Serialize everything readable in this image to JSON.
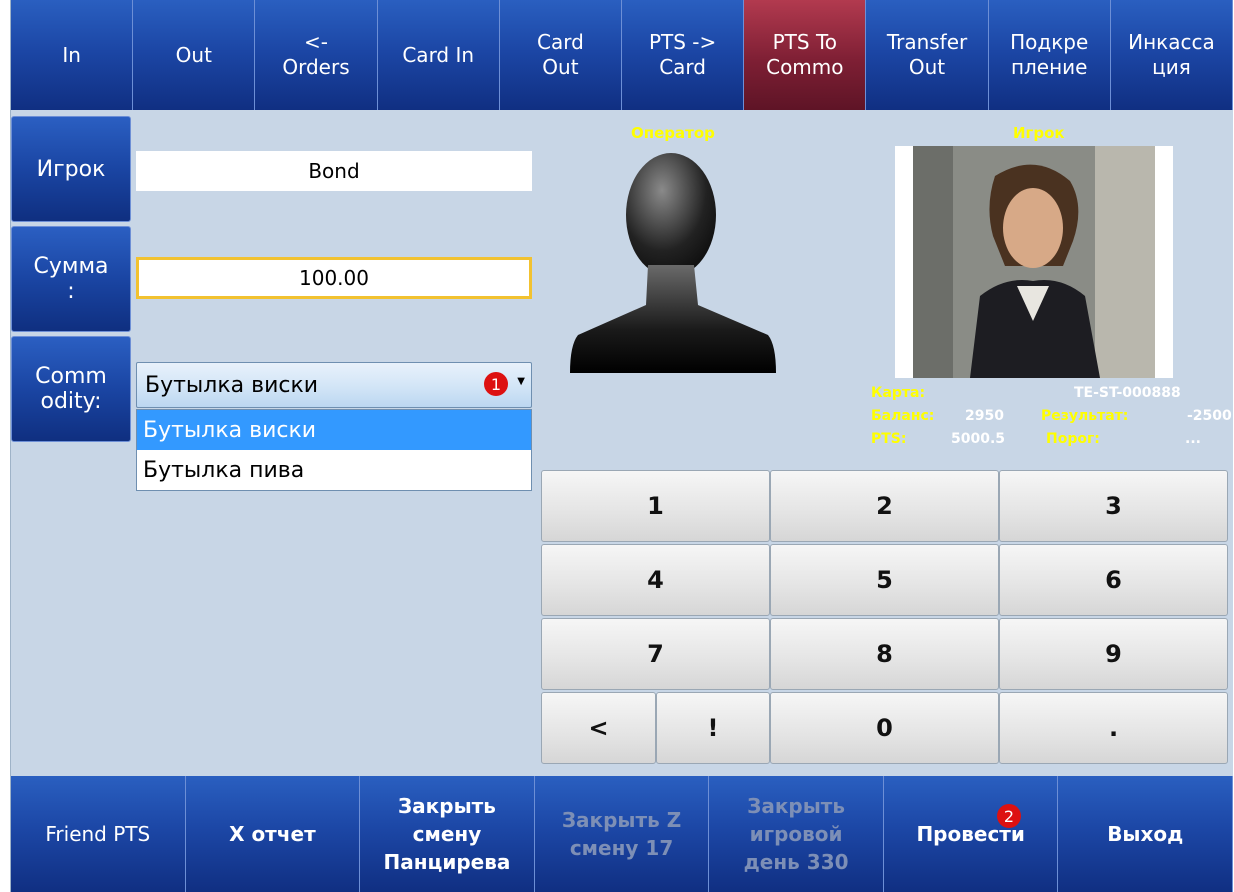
{
  "top_tabs": [
    {
      "label": "In"
    },
    {
      "label": "Out"
    },
    {
      "label": "<-\nOrders"
    },
    {
      "label": "Card In"
    },
    {
      "label": "Card\nOut"
    },
    {
      "label": "PTS ->\nCard"
    },
    {
      "label": "PTS To\nCommo",
      "active": true
    },
    {
      "label": "Transfer\nOut"
    },
    {
      "label": "Подкре\nпление"
    },
    {
      "label": "Инкасса\nция"
    }
  ],
  "form": {
    "player_button": "Игрок",
    "player_value": "Bond",
    "sum_button": "Сумма\n:",
    "sum_value": "100.00",
    "commodity_button": "Comm\nodity:",
    "commodity_selected": "Бутылка виски",
    "commodity_options": [
      "Бутылка виски",
      "Бутылка пива"
    ]
  },
  "badges": {
    "first": "1",
    "second": "2"
  },
  "operator": {
    "label": "Оператор"
  },
  "player": {
    "label": "Игрок",
    "card_label": "Карта:",
    "card_value": "TE-ST-000888",
    "balance_label": "Баланс:",
    "balance_value": "2950",
    "result_label": "Результат:",
    "result_value": "-2500",
    "pts_label": "PTS:",
    "pts_value": "5000.5",
    "threshold_label": "Порог:",
    "threshold_value": "..."
  },
  "keypad": [
    "1",
    "2",
    "3",
    "4",
    "5",
    "6",
    "7",
    "8",
    "9",
    "<",
    "!",
    "0",
    "."
  ],
  "bottom": [
    {
      "label": "Friend PTS",
      "disabled": false
    },
    {
      "label": "X отчет",
      "disabled": false
    },
    {
      "label": "Закрыть\nсмену\nПанцирева",
      "disabled": false
    },
    {
      "label": "Закрыть Z\nсмену 17",
      "disabled": true
    },
    {
      "label": "Закрыть\nигровой\nдень 330",
      "disabled": true
    },
    {
      "label": "Провести",
      "disabled": false
    },
    {
      "label": "Выход",
      "disabled": false
    }
  ],
  "colors": {
    "active_tab": "#7e1f34",
    "nav_blue": "#1c47a6",
    "accent_yellow": "#ffff00",
    "selection_blue": "#3399ff"
  }
}
